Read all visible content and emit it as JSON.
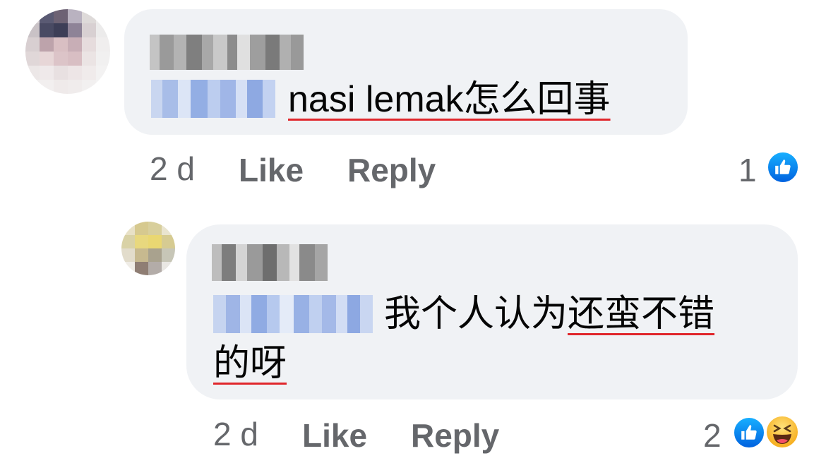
{
  "comments": [
    {
      "text_prefix": "nasi lemak ",
      "text_underlined": "nasi lemak怎么回事",
      "time": "2 d",
      "like_label": "Like",
      "reply_label": "Reply",
      "reaction_count": "1",
      "reactions": [
        "like-icon"
      ]
    },
    {
      "text_plain": "我个人认为",
      "text_underlined_1": "还蛮不错",
      "text_underlined_2": "的呀",
      "time": "2 d",
      "like_label": "Like",
      "reply_label": "Reply",
      "reaction_count": "2",
      "reactions": [
        "like-icon",
        "haha-icon"
      ]
    }
  ],
  "colors": {
    "bubble": "#f0f2f5",
    "meta_text": "#65676b",
    "underline": "#e0262b",
    "like_blue": "#1877f2"
  }
}
